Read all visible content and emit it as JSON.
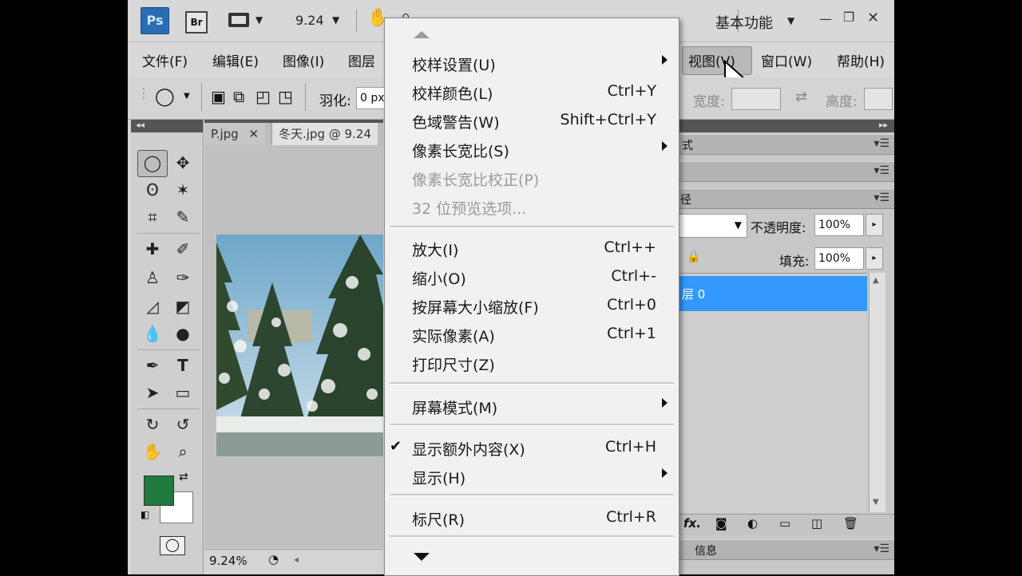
{
  "titlebar": {
    "ps_logo": "Ps",
    "br_logo": "Br",
    "zoom_value": "9.24",
    "workspace": "基本功能"
  },
  "menubar": {
    "items": [
      {
        "label": "文件(F)"
      },
      {
        "label": "编辑(E)"
      },
      {
        "label": "图像(I)"
      },
      {
        "label": "图层"
      },
      {
        "label": "视图(V)"
      },
      {
        "label": "窗口(W)"
      },
      {
        "label": "帮助(H)"
      }
    ]
  },
  "options": {
    "feather_label": "羽化:",
    "feather_value": "0 px",
    "width_label": "宽度:",
    "height_label": "高度:"
  },
  "tabs": [
    {
      "label": "P.jpg"
    },
    {
      "label": "冬天.jpg @ 9.24"
    }
  ],
  "status": {
    "zoom": "9.24%"
  },
  "panels": {
    "panel1_title": "式",
    "panel3_title": "径",
    "opacity_label": "不透明度:",
    "opacity_value": "100%",
    "fill_label": "填充:",
    "fill_value": "100%",
    "layer_name": "层 0",
    "info_tab": "信息",
    "fx_label": "fx."
  },
  "view_menu": {
    "items": [
      {
        "label": "校样设置(U)",
        "shortcut": "",
        "submenu": true,
        "disabled": false
      },
      {
        "label": "校样颜色(L)",
        "shortcut": "Ctrl+Y",
        "submenu": false,
        "disabled": false
      },
      {
        "label": "色域警告(W)",
        "shortcut": "Shift+Ctrl+Y",
        "submenu": false,
        "disabled": false
      },
      {
        "label": "像素长宽比(S)",
        "shortcut": "",
        "submenu": true,
        "disabled": false
      },
      {
        "label": "像素长宽比校正(P)",
        "shortcut": "",
        "submenu": false,
        "disabled": true
      },
      {
        "label": "32 位预览选项...",
        "shortcut": "",
        "submenu": false,
        "disabled": true
      },
      {
        "label": "放大(I)",
        "shortcut": "Ctrl++",
        "submenu": false,
        "disabled": false
      },
      {
        "label": "缩小(O)",
        "shortcut": "Ctrl+-",
        "submenu": false,
        "disabled": false
      },
      {
        "label": "按屏幕大小缩放(F)",
        "shortcut": "Ctrl+0",
        "submenu": false,
        "disabled": false
      },
      {
        "label": "实际像素(A)",
        "shortcut": "Ctrl+1",
        "submenu": false,
        "disabled": false
      },
      {
        "label": "打印尺寸(Z)",
        "shortcut": "",
        "submenu": false,
        "disabled": false
      },
      {
        "label": "屏幕模式(M)",
        "shortcut": "",
        "submenu": true,
        "disabled": false
      },
      {
        "label": "显示额外内容(X)",
        "shortcut": "Ctrl+H",
        "submenu": false,
        "disabled": false,
        "checked": true
      },
      {
        "label": "显示(H)",
        "shortcut": "",
        "submenu": true,
        "disabled": false
      },
      {
        "label": "标尺(R)",
        "shortcut": "Ctrl+R",
        "submenu": false,
        "disabled": false
      }
    ]
  },
  "colors": {
    "foreground": "#1f7a3d",
    "background": "#ffffff",
    "layer_selected": "#3399ff"
  }
}
